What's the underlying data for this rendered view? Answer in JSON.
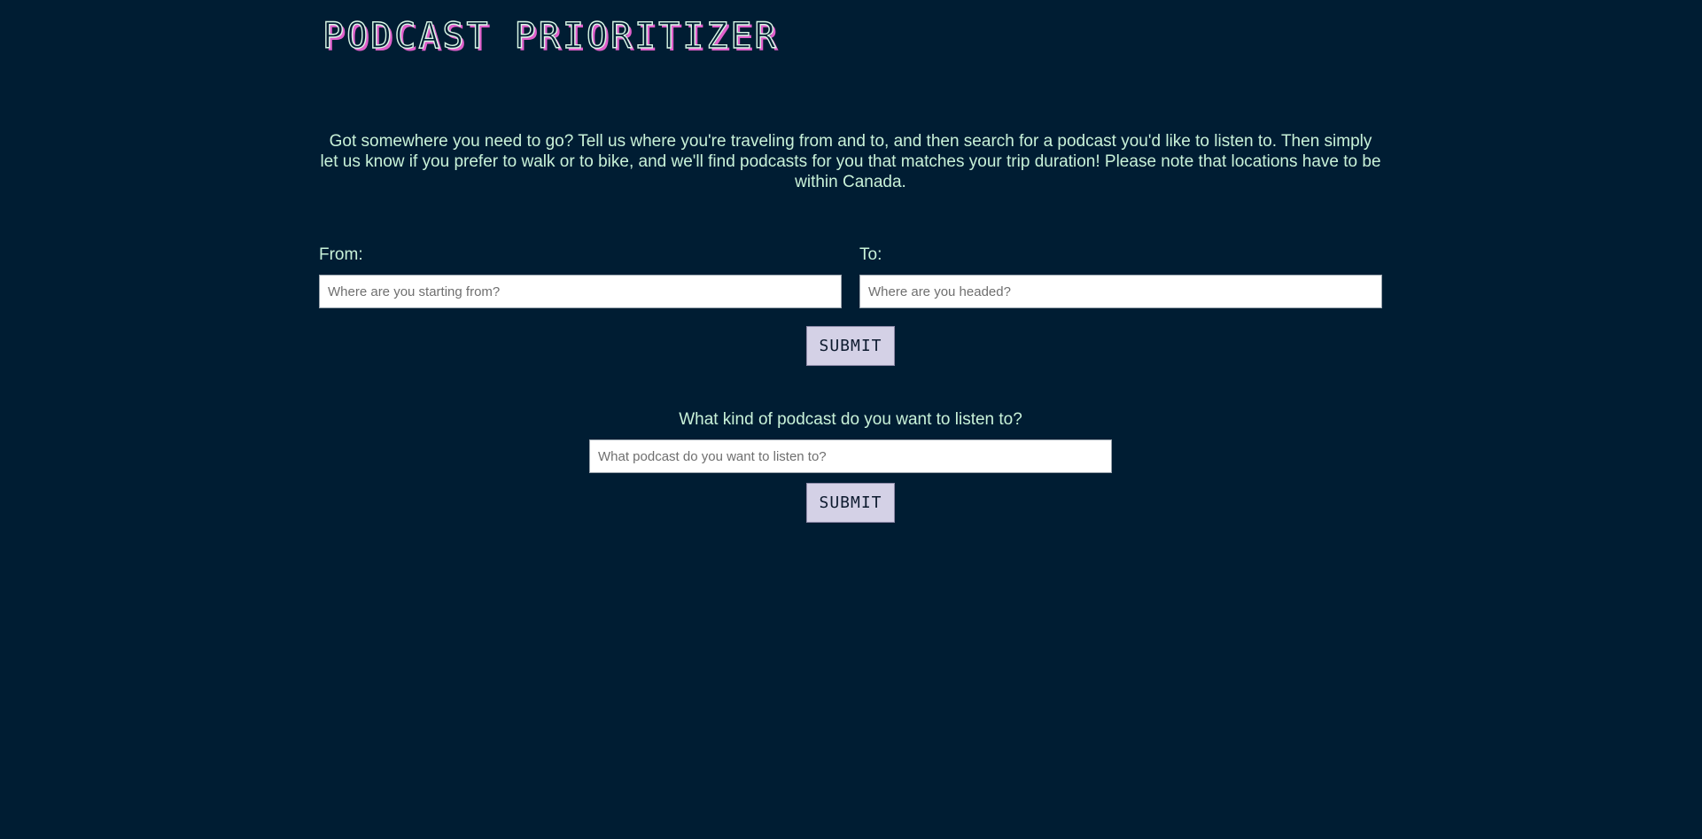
{
  "header": {
    "title": "PODCAST PRIORITIZER"
  },
  "intro": {
    "text": "Got somewhere you need to go? Tell us where you're traveling from and to, and then search for a podcast you'd like to listen to. Then simply let us know if you prefer to walk or to bike, and we'll find podcasts for you that matches your trip duration! Please note that locations have to be within Canada."
  },
  "trip_form": {
    "from_label": "From:",
    "from_placeholder": "Where are you starting from?",
    "from_value": "",
    "to_label": "To:",
    "to_placeholder": "Where are you headed?",
    "to_value": "",
    "submit_label": "SUBMIT"
  },
  "podcast_form": {
    "question": "What kind of podcast do you want to listen to?",
    "placeholder": "What podcast do you want to listen to?",
    "value": "",
    "submit_label": "SUBMIT"
  },
  "colors": {
    "background": "#001d33",
    "text": "#c9f2d9",
    "title_shadow": "#e05fcb",
    "button_bg": "#d4d1e6"
  }
}
